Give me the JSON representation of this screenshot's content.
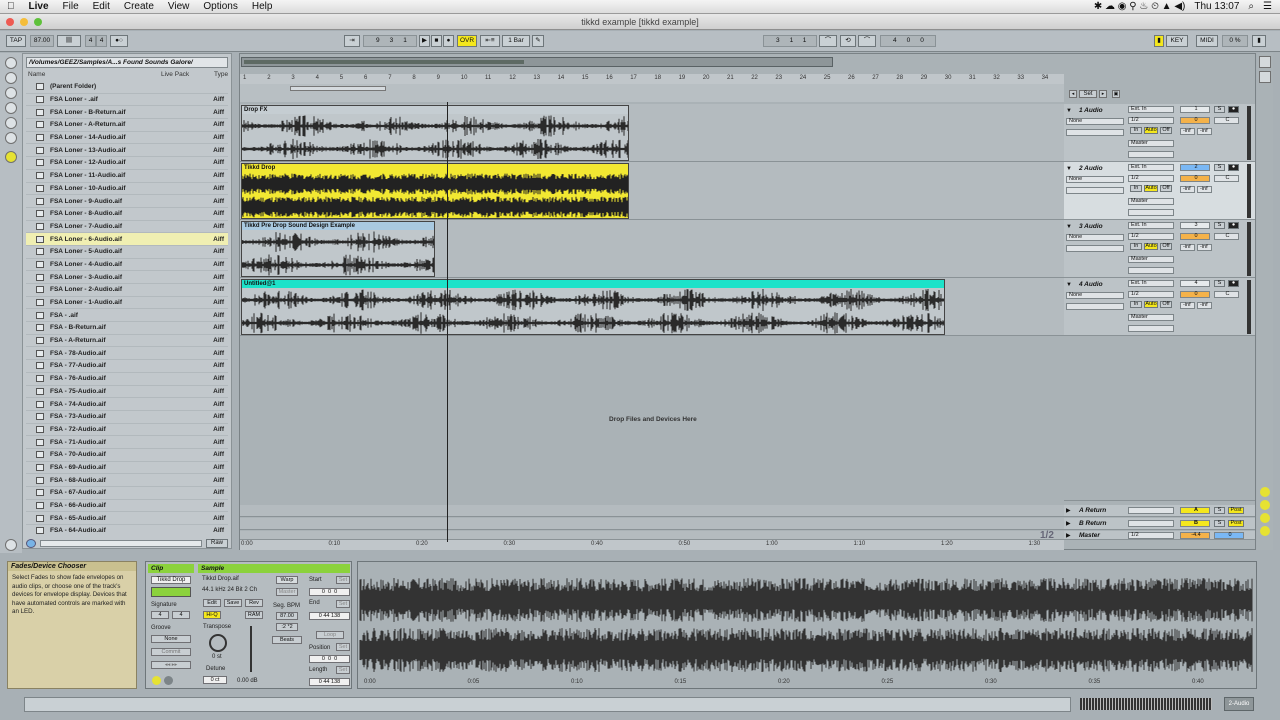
{
  "menubar": {
    "app": "Live",
    "items": [
      "File",
      "Edit",
      "Create",
      "View",
      "Options",
      "Help"
    ],
    "clock": "Thu 13:07"
  },
  "window": {
    "title": "tikkd example  [tikkd example]"
  },
  "control_bar": {
    "tap": "TAP",
    "tempo": "87.00",
    "sig_num": "4",
    "sig_den": "4",
    "pos": [
      "9",
      "3",
      "1"
    ],
    "ovr": "OVR",
    "quantize": "1 Bar",
    "loop_start": [
      "3",
      "1",
      "1"
    ],
    "loop_len": [
      "4",
      "0",
      "0"
    ],
    "key": "KEY",
    "midi": "MIDI",
    "cpu": "0 %"
  },
  "browser": {
    "path": "/Volumes/GEEZ/Samples/A...s Found Sounds Galore/",
    "col_name": "Name",
    "col_pack": "Live Pack",
    "col_type": "Type",
    "raw": "Raw",
    "items": [
      {
        "name": "(Parent Folder)",
        "type": ""
      },
      {
        "name": "FSA Loner - .aif",
        "type": "Aiff"
      },
      {
        "name": "FSA Loner - B-Return.aif",
        "type": "Aiff"
      },
      {
        "name": "FSA Loner - A-Return.aif",
        "type": "Aiff"
      },
      {
        "name": "FSA Loner - 14-Audio.aif",
        "type": "Aiff"
      },
      {
        "name": "FSA Loner - 13-Audio.aif",
        "type": "Aiff"
      },
      {
        "name": "FSA Loner - 12-Audio.aif",
        "type": "Aiff"
      },
      {
        "name": "FSA Loner - 11-Audio.aif",
        "type": "Aiff"
      },
      {
        "name": "FSA Loner - 10-Audio.aif",
        "type": "Aiff"
      },
      {
        "name": "FSA Loner - 9-Audio.aif",
        "type": "Aiff"
      },
      {
        "name": "FSA Loner - 8-Audio.aif",
        "type": "Aiff"
      },
      {
        "name": "FSA Loner - 7-Audio.aif",
        "type": "Aiff"
      },
      {
        "name": "FSA Loner - 6-Audio.aif",
        "type": "Aiff"
      },
      {
        "name": "FSA Loner - 5-Audio.aif",
        "type": "Aiff"
      },
      {
        "name": "FSA Loner - 4-Audio.aif",
        "type": "Aiff"
      },
      {
        "name": "FSA Loner - 3-Audio.aif",
        "type": "Aiff"
      },
      {
        "name": "FSA Loner - 2-Audio.aif",
        "type": "Aiff"
      },
      {
        "name": "FSA Loner - 1-Audio.aif",
        "type": "Aiff"
      },
      {
        "name": "FSA - .aif",
        "type": "Aiff"
      },
      {
        "name": "FSA - B-Return.aif",
        "type": "Aiff"
      },
      {
        "name": "FSA - A-Return.aif",
        "type": "Aiff"
      },
      {
        "name": "FSA - 78-Audio.aif",
        "type": "Aiff"
      },
      {
        "name": "FSA - 77-Audio.aif",
        "type": "Aiff"
      },
      {
        "name": "FSA - 76-Audio.aif",
        "type": "Aiff"
      },
      {
        "name": "FSA - 75-Audio.aif",
        "type": "Aiff"
      },
      {
        "name": "FSA - 74-Audio.aif",
        "type": "Aiff"
      },
      {
        "name": "FSA - 73-Audio.aif",
        "type": "Aiff"
      },
      {
        "name": "FSA - 72-Audio.aif",
        "type": "Aiff"
      },
      {
        "name": "FSA - 71-Audio.aif",
        "type": "Aiff"
      },
      {
        "name": "FSA - 70-Audio.aif",
        "type": "Aiff"
      },
      {
        "name": "FSA - 69-Audio.aif",
        "type": "Aiff"
      },
      {
        "name": "FSA - 68-Audio.aif",
        "type": "Aiff"
      },
      {
        "name": "FSA - 67-Audio.aif",
        "type": "Aiff"
      },
      {
        "name": "FSA - 66-Audio.aif",
        "type": "Aiff"
      },
      {
        "name": "FSA - 65-Audio.aif",
        "type": "Aiff"
      },
      {
        "name": "FSA - 64-Audio.aif",
        "type": "Aiff"
      }
    ],
    "selected_index": 12
  },
  "arrangement": {
    "bar_numbers": [
      "1",
      "2",
      "3",
      "4",
      "5",
      "6",
      "7",
      "8",
      "9",
      "10",
      "11",
      "12",
      "13",
      "14",
      "15",
      "16",
      "17",
      "18",
      "19",
      "20",
      "21",
      "22",
      "23",
      "24",
      "25",
      "26",
      "27",
      "28",
      "29",
      "30",
      "31",
      "32",
      "33",
      "34"
    ],
    "time_labels": [
      "0:00",
      "0:10",
      "0:20",
      "0:30",
      "0:40",
      "0:50",
      "1:00",
      "1:10",
      "1:20",
      "1:30"
    ],
    "drop_text": "Drop Files and Devices Here",
    "page": "1/2",
    "set_label": "Set",
    "tracks": [
      {
        "name": "1 Audio",
        "clip": "Drop FX",
        "color": "#c5cdd2",
        "wavecolor": "#2a2a2a",
        "num": "1",
        "sel_color": "#e6eaec"
      },
      {
        "name": "2 Audio",
        "clip": "Tikkd Drop",
        "color": "#f2e832",
        "wavecolor": "#222",
        "num": "2",
        "sel_color": "#7ab8f5"
      },
      {
        "name": "3 Audio",
        "clip": "Tikkd Pre Drop Sound Design Example",
        "color": "#a9c9e0",
        "wavecolor": "#2a2a2a",
        "num": "3",
        "sel_color": "#e6eaec"
      },
      {
        "name": "4 Audio",
        "clip": "Untitled@1",
        "color": "#1de2c9",
        "wavecolor": "#2a2a2a",
        "num": "4",
        "sel_color": "#e6eaec"
      }
    ],
    "io": {
      "input": "Ext. In",
      "channel": "1/2",
      "monitor_in": "In",
      "monitor_auto": "Auto",
      "monitor_off": "Off",
      "output": "Master",
      "none": "None",
      "inf": "-inf",
      "vol": "0",
      "pan": "C",
      "solo": "S"
    },
    "returns": [
      {
        "name": "A Return",
        "letter": "A",
        "post": "Post"
      },
      {
        "name": "B Return",
        "letter": "B",
        "post": "Post"
      }
    ],
    "master": {
      "name": "Master",
      "channel": "1/2",
      "vol": "-4.4",
      "pan": "0"
    }
  },
  "info": {
    "title": "Fades/Device Chooser",
    "body": "Select Fades to show fade envelopes on audio clips, or choose one of the track's devices for envelope display. Devices that have automated controls are marked with an LED."
  },
  "clip_view": {
    "clip_label": "Clip",
    "clip_name": "Tikkd Drop",
    "signature": "Signature",
    "sig_num": "4",
    "sig_den": "4",
    "groove": "Groove",
    "groove_val": "None",
    "commit": "Commit",
    "sample_label": "Sample",
    "sample_name": "Tikkd Drop.aif",
    "sample_info": "44.1 kHz 24 Bit 2 Ch",
    "edit": "Edit",
    "save": "Save",
    "rev": "Rev",
    "hiq": "Hi-Q",
    "ram": "RAM",
    "warp": "Warp",
    "master_btn": "Master",
    "seg_bpm": "Seg. BPM",
    "bpm_val": "87.00",
    "transpose": "Transpose",
    "transpose_val": "0 st",
    "detune": "Detune",
    "detune_val": "0 ct",
    "gain_val": "0.00 dB",
    "beats": "Beats",
    "start": "Start",
    "end": "End",
    "loop": "Loop",
    "position": "Position",
    "length": "Length",
    "set": "Set"
  },
  "sample_view": {
    "time_labels": [
      "0:00",
      "0:05",
      "0:10",
      "0:15",
      "0:20",
      "0:25",
      "0:30",
      "0:35",
      "0:40"
    ]
  },
  "status": {
    "track": "2-Audio"
  }
}
